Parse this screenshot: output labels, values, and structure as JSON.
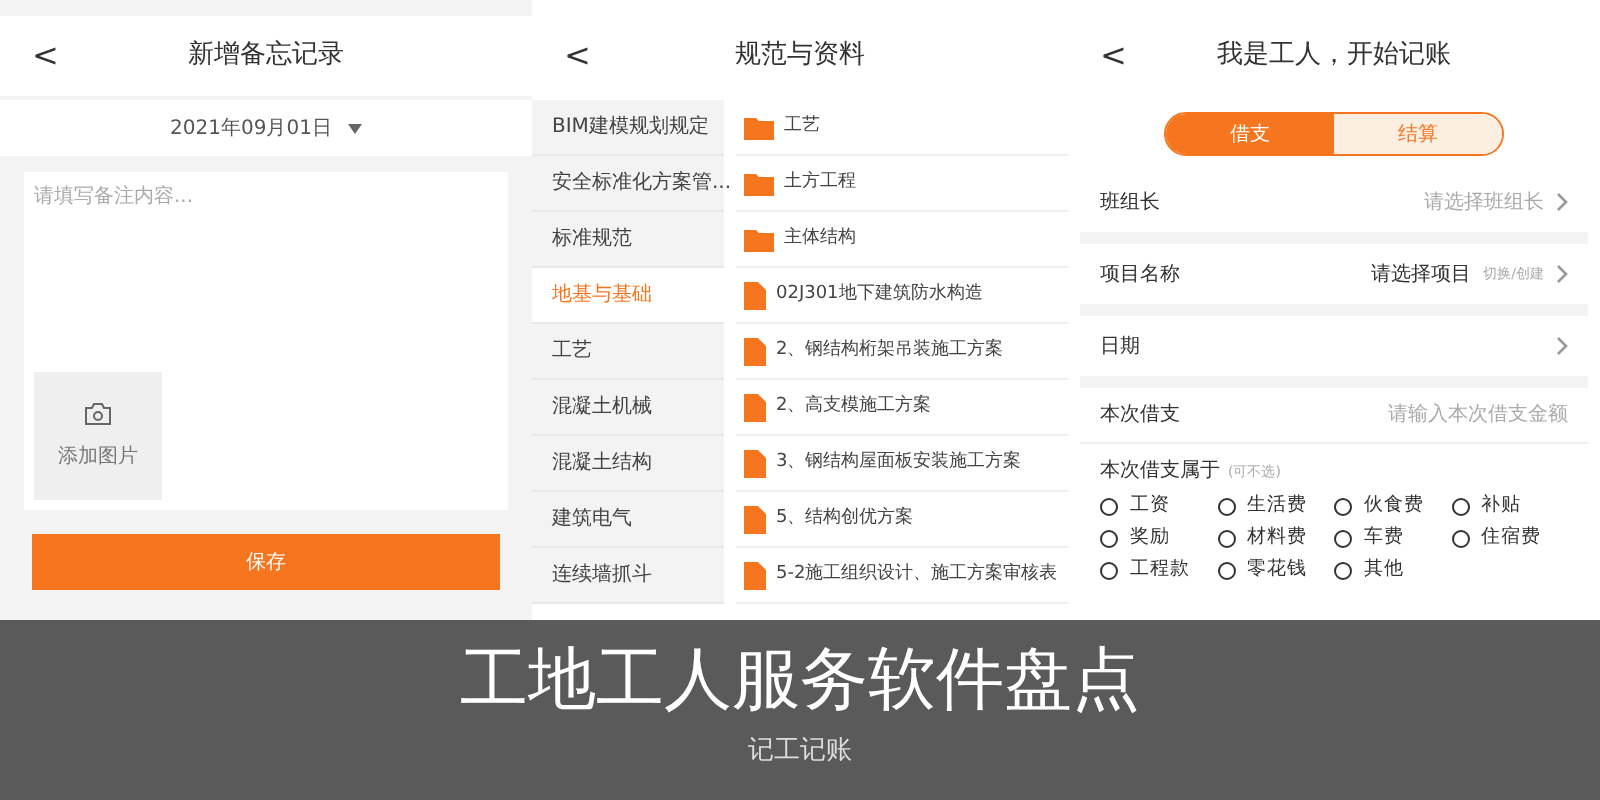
{
  "memo_screen": {
    "back": "<",
    "title": "新增备忘记录",
    "date": "2021年09月01日",
    "note_field": {
      "placeholder": "请填写备注内容..."
    },
    "add_photo": "添加图片",
    "save_button": "保存"
  },
  "docs_screen": {
    "back": "<",
    "title": "规范与资料",
    "categories": [
      {
        "label": "BIM建模规划规定",
        "selected": false
      },
      {
        "label": "安全标准化方案管...",
        "selected": false
      },
      {
        "label": "标准规范",
        "selected": false
      },
      {
        "label": "地基与基础",
        "selected": true
      },
      {
        "label": "工艺",
        "selected": false
      },
      {
        "label": "混凝土机械",
        "selected": false
      },
      {
        "label": "混凝土结构",
        "selected": false
      },
      {
        "label": "建筑电气",
        "selected": false
      },
      {
        "label": "连续墙抓斗",
        "selected": false
      }
    ],
    "files": [
      {
        "kind": "folder",
        "label": "工艺"
      },
      {
        "kind": "folder",
        "label": "土方工程"
      },
      {
        "kind": "folder",
        "label": "主体结构"
      },
      {
        "kind": "file",
        "label": "02J301地下建筑防水构造"
      },
      {
        "kind": "file",
        "label": "2、钢结构桁架吊装施工方案"
      },
      {
        "kind": "file",
        "label": "2、高支模施工方案"
      },
      {
        "kind": "file",
        "label": "3、钢结构屋面板安装施工方案"
      },
      {
        "kind": "file",
        "label": "5、结构创优方案"
      },
      {
        "kind": "file",
        "label": "5-2施工组织设计、施工方案审核表"
      }
    ]
  },
  "ledger_screen": {
    "back": "<",
    "title": "我是工人，开始记账",
    "tabs": [
      {
        "label": "借支",
        "selected": true
      },
      {
        "label": "结算",
        "selected": false
      }
    ],
    "rows": [
      {
        "label": "班组长",
        "value": "请选择班组长",
        "arrow": true
      },
      {
        "label": "项目名称",
        "value": "请选择项目",
        "hint": "切换/创建",
        "arrow": true
      },
      {
        "label": "日期",
        "arrow": true
      }
    ],
    "amount": {
      "label": "本次借支",
      "placeholder": "请输入本次借支金额"
    },
    "category_label": "本次借支属于",
    "category_hint": "(可不选)",
    "options": [
      {
        "label": "工资",
        "selected": false
      },
      {
        "label": "生活费",
        "selected": false
      },
      {
        "label": "伙食费",
        "selected": false
      },
      {
        "label": "补贴",
        "selected": false
      },
      {
        "label": "奖励",
        "selected": false
      },
      {
        "label": "材料费",
        "selected": false
      },
      {
        "label": "车费",
        "selected": false
      },
      {
        "label": "住宿费",
        "selected": false
      },
      {
        "label": "工程款",
        "selected": false
      },
      {
        "label": "零花钱",
        "selected": false
      },
      {
        "label": "其他",
        "selected": false
      }
    ]
  },
  "banner": {
    "title": "工地工人服务软件盘点",
    "subtitle": "记工记账"
  }
}
